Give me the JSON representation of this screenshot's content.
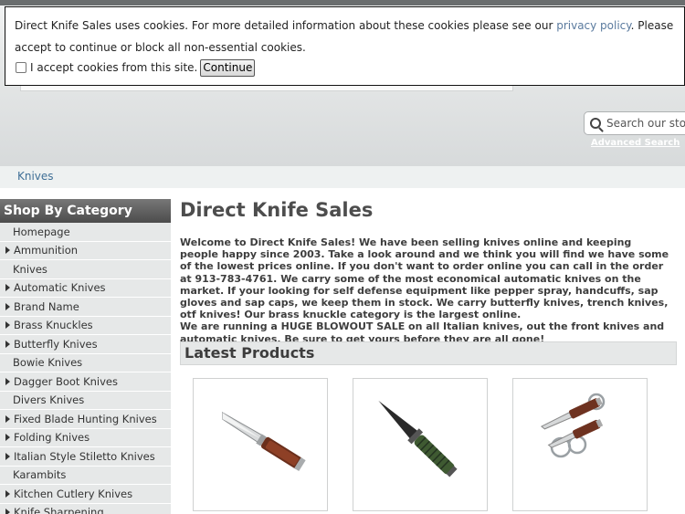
{
  "cookie_banner": {
    "text_before_link": "Direct Knife Sales uses cookies. For more detailed information about these cookies please see our ",
    "link": "privacy policy",
    "text_after_link": ". Please accept to continue or block all non-essential cookies.",
    "checkbox_label": "I accept cookies from this site.",
    "button": "Continue"
  },
  "search": {
    "placeholder": "Search our store",
    "advanced": "Advanced Search"
  },
  "breadcrumb": "Knives",
  "sidebar": {
    "heading": "Shop By Category",
    "items": [
      {
        "label": "Homepage",
        "arrow": false
      },
      {
        "label": "Ammunition",
        "arrow": true
      },
      {
        "label": "Knives",
        "arrow": false
      },
      {
        "label": "Automatic Knives",
        "arrow": true
      },
      {
        "label": "Brand Name",
        "arrow": true
      },
      {
        "label": "Brass Knuckles",
        "arrow": true
      },
      {
        "label": "Butterfly Knives",
        "arrow": true
      },
      {
        "label": "Bowie Knives",
        "arrow": false
      },
      {
        "label": "Dagger Boot Knives",
        "arrow": true
      },
      {
        "label": "Divers Knives",
        "arrow": false
      },
      {
        "label": "Fixed Blade Hunting Knives",
        "arrow": true
      },
      {
        "label": "Folding Knives",
        "arrow": true
      },
      {
        "label": "Italian Style Stiletto Knives",
        "arrow": true
      },
      {
        "label": "Karambits",
        "arrow": false
      },
      {
        "label": "Kitchen Cutlery Knives",
        "arrow": true
      },
      {
        "label": "Knife Sharpening",
        "arrow": true
      }
    ]
  },
  "main": {
    "title": "Direct Knife Sales",
    "intro_1": "Welcome to Direct Knife Sales! We have been selling knives online and keeping people happy since 2003. Take a look around and we think you will find we have some of the lowest prices online.  If you don't want to order online you can call in the order at 913-783-4761. We carry some of the most economical automatic knives on the market. If your looking for self defense equipment like pepper spray, handcuffs, sap gloves and sap caps, we keep them in stock. We carry butterfly knives, trench knives, otf knives! Our brass knuckle category is the largest online.",
    "intro_2": "We are running a HUGE BLOWOUT SALE on all Italian knives, out the front knives and automatic knives. Be sure to get yours before they are all gone!",
    "latest_heading": "Latest Products"
  },
  "icons": {
    "search": "search-icon",
    "arrow": "triangle-right-icon"
  }
}
